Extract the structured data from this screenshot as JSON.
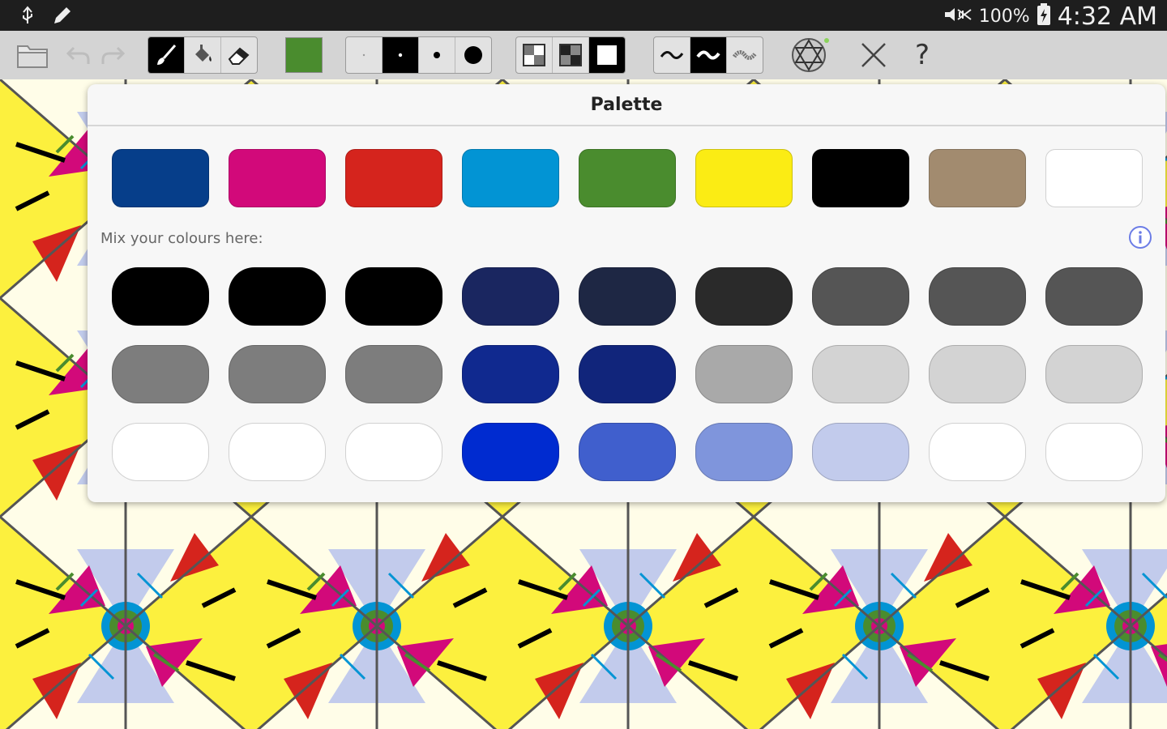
{
  "status_bar": {
    "battery_text": "100%",
    "clock": "4:32 AM",
    "icons": [
      "usb-icon",
      "pencil-icon",
      "mute-icon",
      "battery-icon"
    ]
  },
  "toolbar": {
    "current_color": "#4a8c2e",
    "tools": [
      "brush",
      "fill-bucket",
      "eraser"
    ],
    "active_tool": "brush",
    "sizes": [
      "tiny",
      "small",
      "medium",
      "large"
    ],
    "active_size": "small",
    "opacity_modes": [
      "low",
      "medium",
      "full"
    ],
    "active_opacity": "full",
    "stroke_styles": [
      "smooth",
      "bold",
      "textured"
    ],
    "active_stroke": "bold"
  },
  "palette": {
    "title": "Palette",
    "mix_label": "Mix your colours here:",
    "base_colors": [
      "#063e8a",
      "#d2097a",
      "#d5241d",
      "#0294d4",
      "#4a8c2e",
      "#fbec14",
      "#000000",
      "#a28b6f",
      "#ffffff"
    ],
    "mix_rows": [
      [
        "#000000",
        "#000000",
        "#000000",
        "#1a2660",
        "#1e2744",
        "#2a2a2a",
        "#555555",
        "#555555",
        "#555555"
      ],
      [
        "#7d7d7d",
        "#7d7d7d",
        "#7d7d7d",
        "#10298f",
        "#11257b",
        "#a9a9a9",
        "#d3d3d3",
        "#d3d3d3",
        "#d3d3d3"
      ],
      [
        "#ffffff",
        "#ffffff",
        "#ffffff",
        "#002bd0",
        "#405fcd",
        "#7f95dc",
        "#c2cbec",
        "#ffffff",
        "#ffffff"
      ]
    ]
  }
}
